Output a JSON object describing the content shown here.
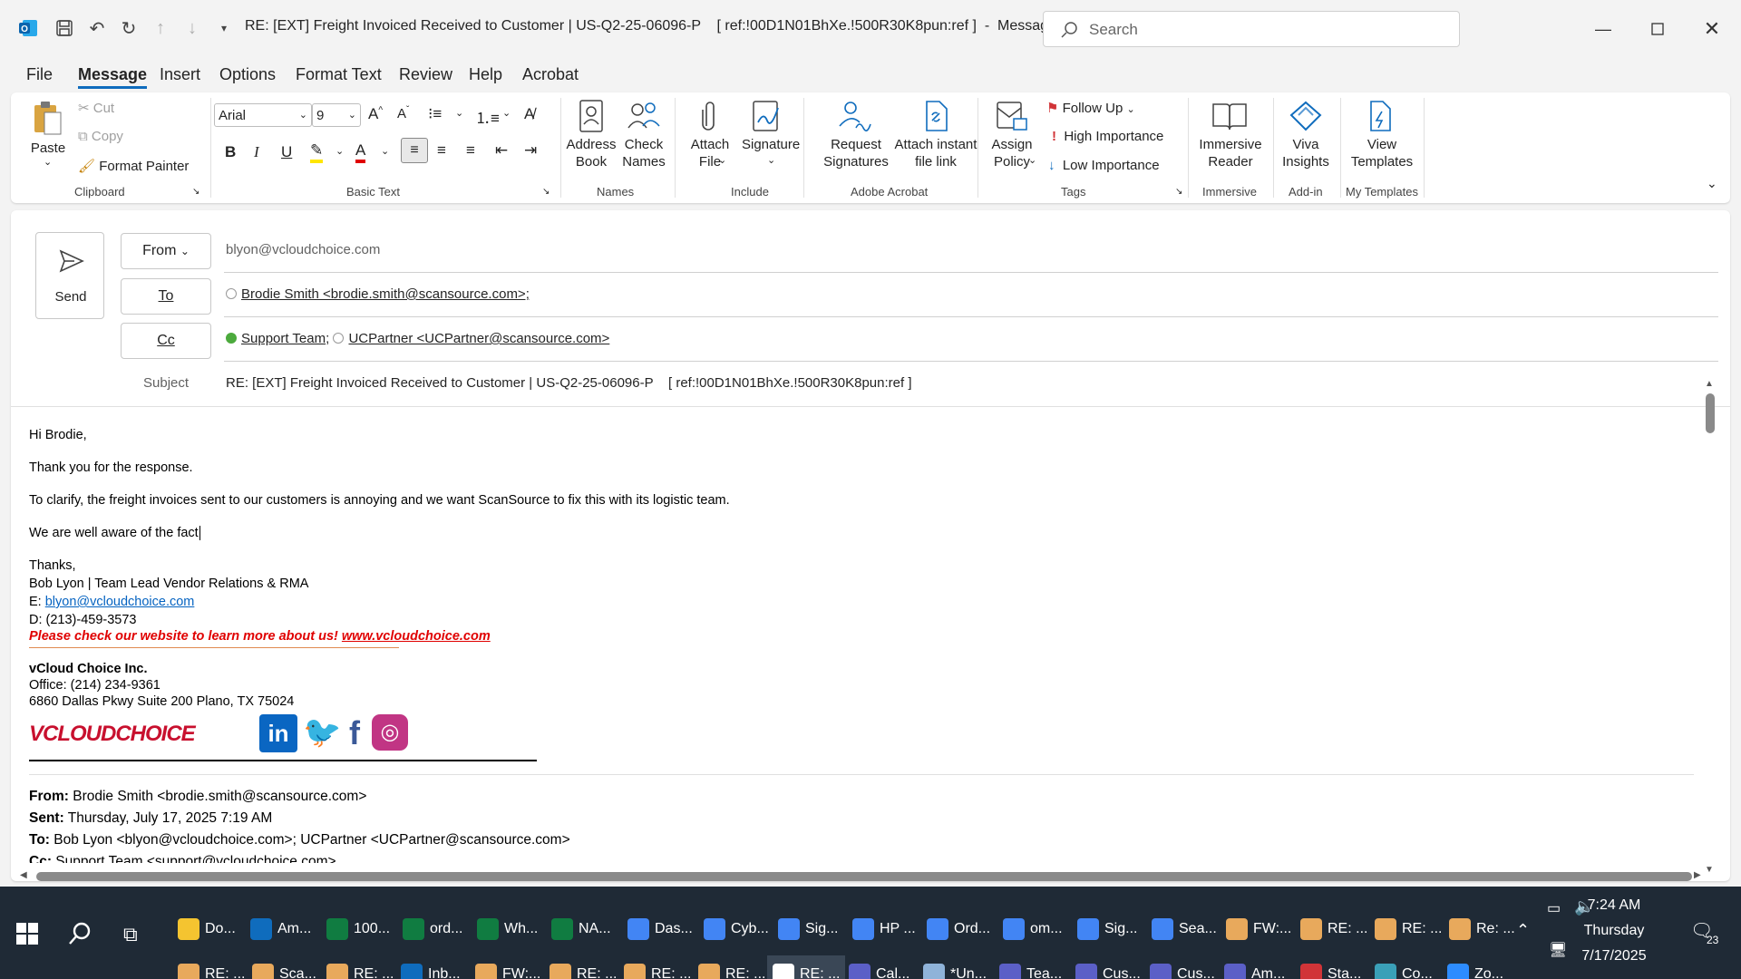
{
  "window": {
    "title": "RE: [EXT] Freight Invoiced Received to Customer | US-Q2-25-06096-P    [ ref:!00D1N01BhXe.!500R30K8pun:ref ]  -  Message (HT...",
    "search_placeholder": "Search"
  },
  "menu": [
    "File",
    "Message",
    "Insert",
    "Options",
    "Format Text",
    "Review",
    "Help",
    "Acrobat"
  ],
  "ribbon": {
    "clipboard": {
      "paste": "Paste",
      "cut": "Cut",
      "copy": "Copy",
      "format_painter": "Format Painter",
      "label": "Clipboard"
    },
    "basic_text": {
      "font": "Arial",
      "size": "9",
      "label": "Basic Text"
    },
    "names": {
      "address_book": "Address\nBook",
      "check_names": "Check\nNames",
      "label": "Names"
    },
    "include": {
      "attach_file": "Attach\nFile",
      "signature": "Signature",
      "label": "Include"
    },
    "acrobat": {
      "request_signatures": "Request\nSignatures",
      "attach_link": "Attach instant\nfile link",
      "label": "Adobe Acrobat"
    },
    "tags": {
      "assign_policy": "Assign\nPolicy",
      "follow_up": "Follow Up",
      "high": "High Importance",
      "low": "Low Importance",
      "label": "Tags"
    },
    "immersive": {
      "reader": "Immersive\nReader",
      "label": "Immersive"
    },
    "addin": {
      "viva": "Viva\nInsights",
      "label": "Add-in"
    },
    "templates": {
      "view": "View\nTemplates",
      "label": "My Templates"
    }
  },
  "compose": {
    "send": "Send",
    "from_label": "From",
    "from_value": "blyon@vcloudchoice.com",
    "to_label": "To",
    "to_value": "Brodie Smith <brodie.smith@scansource.com>;",
    "cc_label": "Cc",
    "cc_value1": "Support Team",
    "cc_sep": ";",
    "cc_value2": "UCPartner <UCPartner@scansource.com>",
    "subject_label": "Subject",
    "subject_value": "RE: [EXT] Freight Invoiced Received to Customer | US-Q2-25-06096-P    [ ref:!00D1N01BhXe.!500R30K8pun:ref ]"
  },
  "body": {
    "greeting": "Hi Brodie,",
    "line1": "Thank you for the response.",
    "line2": "To clarify, the freight invoices sent to our customers is annoying and we want ScanSource to fix this with its logistic team.",
    "line3": "We are well aware of the fact",
    "thanks": "Thanks,",
    "sig_name": "Bob Lyon | Team Lead Vendor Relations & RMA",
    "sig_email_label": "E: ",
    "sig_email": "blyon@vcloudchoice.com",
    "sig_phone": "D: (213)-459-3573",
    "sig_promo": "Please check our website to learn more about us!",
    "sig_site": "www.vcloudchoice.com",
    "company": "vCloud Choice Inc.",
    "office": "Office: (214) 234-9361",
    "address": "6860 Dallas Pkwy Suite 200 Plano, TX 75024",
    "logo_text": "VCLOUDCHOICE",
    "from_lbl": "From:",
    "from_val": " Brodie Smith <brodie.smith@scansource.com>",
    "sent_lbl": "Sent:",
    "sent_val": " Thursday, July 17, 2025 7:19 AM",
    "to_lbl": "To:",
    "to_val": " Bob Lyon <blyon@vcloudchoice.com>; UCPartner <UCPartner@scansource.com>",
    "cc_lbl": "Cc:",
    "cc_val": " Support Team <support@vcloudchoice.com>"
  },
  "taskbar": {
    "row1": [
      "Do...",
      "Am...",
      "100...",
      "ord...",
      "Wh...",
      "NA...",
      "Das...",
      "Cyb...",
      "Sig...",
      "HP ...",
      "Ord...",
      "om...",
      "Sig...",
      "Sea...",
      "FW:...",
      "RE: ...",
      "RE: ...",
      "Re: ..."
    ],
    "row2": [
      "RE: ...",
      "Sca...",
      "RE: ...",
      "Inb...",
      "FW:...",
      "RE: ...",
      "RE: ...",
      "RE: ...",
      "RE: ...",
      "Cal...",
      "*Un...",
      "Tea...",
      "Cus...",
      "Cus...",
      "Am...",
      "Sta...",
      "Co...",
      "Zo..."
    ],
    "time": "7:24 AM",
    "day": "Thursday",
    "date": "7/17/2025",
    "notif": "23"
  }
}
